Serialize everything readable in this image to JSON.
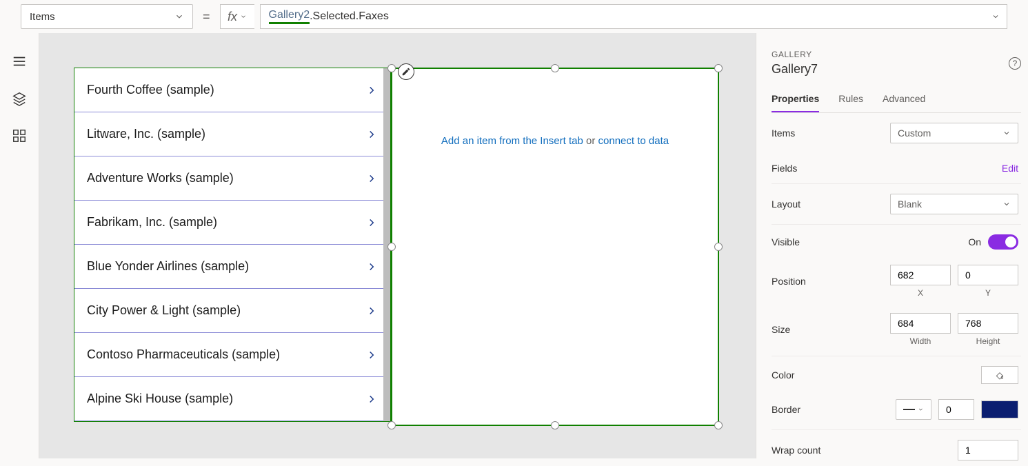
{
  "formula_bar": {
    "property": "Items",
    "equals": "=",
    "fx": "fx",
    "formula_token1": "Gallery2",
    "formula_token2": ".Selected.Faxes"
  },
  "gallery2_items": [
    "Fourth Coffee (sample)",
    "Litware, Inc. (sample)",
    "Adventure Works (sample)",
    "Fabrikam, Inc. (sample)",
    "Blue Yonder Airlines (sample)",
    "City Power & Light (sample)",
    "Contoso Pharmaceuticals (sample)",
    "Alpine Ski House (sample)"
  ],
  "gallery7_empty": {
    "link1": "Add an item from the Insert tab",
    "or": " or ",
    "link2": "connect to data"
  },
  "panel": {
    "type": "GALLERY",
    "name": "Gallery7",
    "tabs": {
      "properties": "Properties",
      "rules": "Rules",
      "advanced": "Advanced"
    },
    "items_label": "Items",
    "items_value": "Custom",
    "fields_label": "Fields",
    "fields_edit": "Edit",
    "layout_label": "Layout",
    "layout_value": "Blank",
    "visible_label": "Visible",
    "visible_value": "On",
    "position_label": "Position",
    "position_x": "682",
    "position_y": "0",
    "x_label": "X",
    "y_label": "Y",
    "size_label": "Size",
    "size_w": "684",
    "size_h": "768",
    "w_label": "Width",
    "h_label": "Height",
    "color_label": "Color",
    "border_label": "Border",
    "border_width": "0",
    "wrap_label": "Wrap count",
    "wrap_value": "1",
    "help": "?"
  },
  "icons": {
    "chevron_down": "chevron"
  }
}
